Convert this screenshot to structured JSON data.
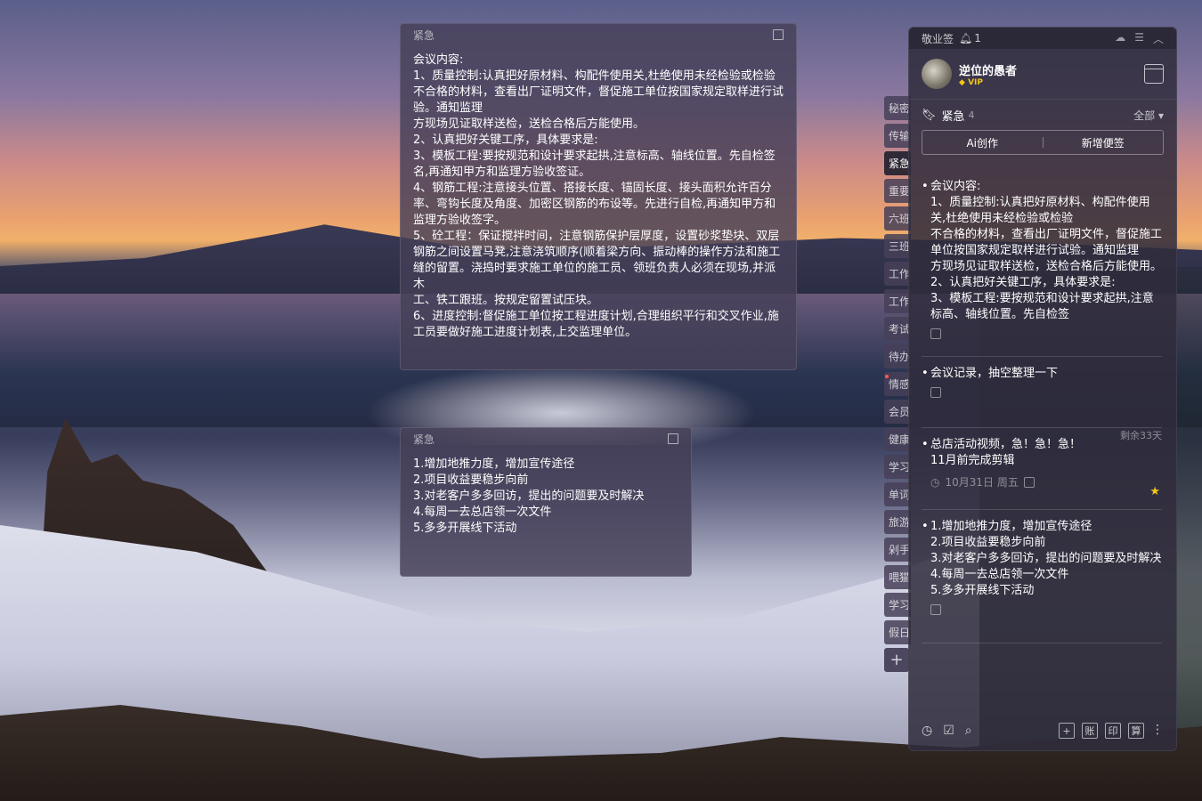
{
  "note1": {
    "title": "紧急",
    "content": "会议内容:\n1、质量控制:认真把好原材料、构配件使用关,杜绝使用未经检验或检验不合格的材料，查看出厂证明文件，督促施工单位按国家规定取样进行试验。通知监理\n方现场见证取样送检，送检合格后方能使用。\n2、认真把好关键工序，具体要求是:\n3、模板工程:要按规范和设计要求起拱,注意标高、轴线位置。先自检签名,再通知甲方和监理方验收签证。\n4、钢筋工程:注意接头位置、搭接长度、锚固长度、接头面积允许百分率、弯钩长度及角度、加密区钢筋的布设等。先进行自检,再通知甲方和监理方验收签字。\n5、砼工程：保证搅拌时间，注意钢筋保护层厚度，设置砂浆垫块、双层钢筋之间设置马凳,注意浇筑顺序(顺着梁方向、振动棒的操作方法和施工缝的留置。浇捣时要求施工单位的施工员、领班负责人必须在现场,并派木\n工、铁工跟班。按规定留置试压块。\n6、进度控制:督促施工单位按工程进度计划,合理组织平行和交叉作业,施工员要做好施工进度计划表,上交监理单位。"
  },
  "note2": {
    "title": "紧急",
    "content": "1.增加地推力度，增加宣传途径\n2.项目收益要稳步向前\n3.对老客户多多回访，提出的问题要及时解决\n4.每周一去总店领一次文件\n5.多多开展线下活动"
  },
  "tabs": [
    {
      "label": "秘密",
      "active": false,
      "dot": false
    },
    {
      "label": "传输",
      "active": false,
      "dot": false
    },
    {
      "label": "紧急",
      "active": true,
      "dot": false
    },
    {
      "label": "重要",
      "active": false,
      "dot": false
    },
    {
      "label": "六班",
      "active": false,
      "dot": false
    },
    {
      "label": "三班",
      "active": false,
      "dot": false
    },
    {
      "label": "工作",
      "active": false,
      "dot": false
    },
    {
      "label": "工作",
      "active": false,
      "dot": false
    },
    {
      "label": "考试",
      "active": false,
      "dot": false
    },
    {
      "label": "待办",
      "active": false,
      "dot": false
    },
    {
      "label": "情感",
      "active": false,
      "dot": true
    },
    {
      "label": "会员",
      "active": false,
      "dot": false
    },
    {
      "label": "健康",
      "active": false,
      "dot": false
    },
    {
      "label": "学习",
      "active": false,
      "dot": false
    },
    {
      "label": "单词",
      "active": false,
      "dot": false
    },
    {
      "label": "旅游",
      "active": false,
      "dot": false
    },
    {
      "label": "剁手",
      "active": false,
      "dot": false
    },
    {
      "label": "喂猫",
      "active": false,
      "dot": false
    },
    {
      "label": "学习",
      "active": false,
      "dot": false
    },
    {
      "label": "假日",
      "active": false,
      "dot": false
    }
  ],
  "tabs_add": "+",
  "panel": {
    "app_name": "敬业签",
    "notif_count": "1",
    "user_name": "逆位的愚者",
    "vip_label": "VIP",
    "category": "紧急",
    "category_count": "4",
    "filter": "全部",
    "ai_button": "Ai创作",
    "new_button": "新增便签",
    "items": [
      {
        "text": "会议内容:\n1、质量控制:认真把好原材料、构配件使用关,杜绝使用未经检验或检验\n不合格的材料，查看出厂证明文件，督促施工单位按国家规定取样进行试验。通知监理\n方现场见证取样送检，送检合格后方能使用。\n2、认真把好关键工序，具体要求是:\n3、模板工程:要按规范和设计要求起拱,注意标高、轴线位置。先自检签",
        "meta": "",
        "corner": "",
        "star": false
      },
      {
        "text": "会议记录，抽空整理一下",
        "meta": "",
        "corner": "",
        "star": false
      },
      {
        "text": "总店活动视频，急！急！急！\n11月前完成剪辑",
        "meta": "10月31日 周五",
        "corner": "剩余33天",
        "star": true
      },
      {
        "text": "1.增加地推力度，增加宣传途径\n2.项目收益要稳步向前\n3.对老客户多多回访，提出的问题要及时解决\n4.每周一去总店领一次文件\n5.多多开展线下活动",
        "meta": "",
        "corner": "",
        "star": false
      }
    ],
    "footer_boxes": [
      "+",
      "账",
      "印",
      "算"
    ]
  },
  "colors": {
    "accent_star": "#f5c518",
    "note_bg": "#464058",
    "panel_bg": "#302c3c"
  }
}
